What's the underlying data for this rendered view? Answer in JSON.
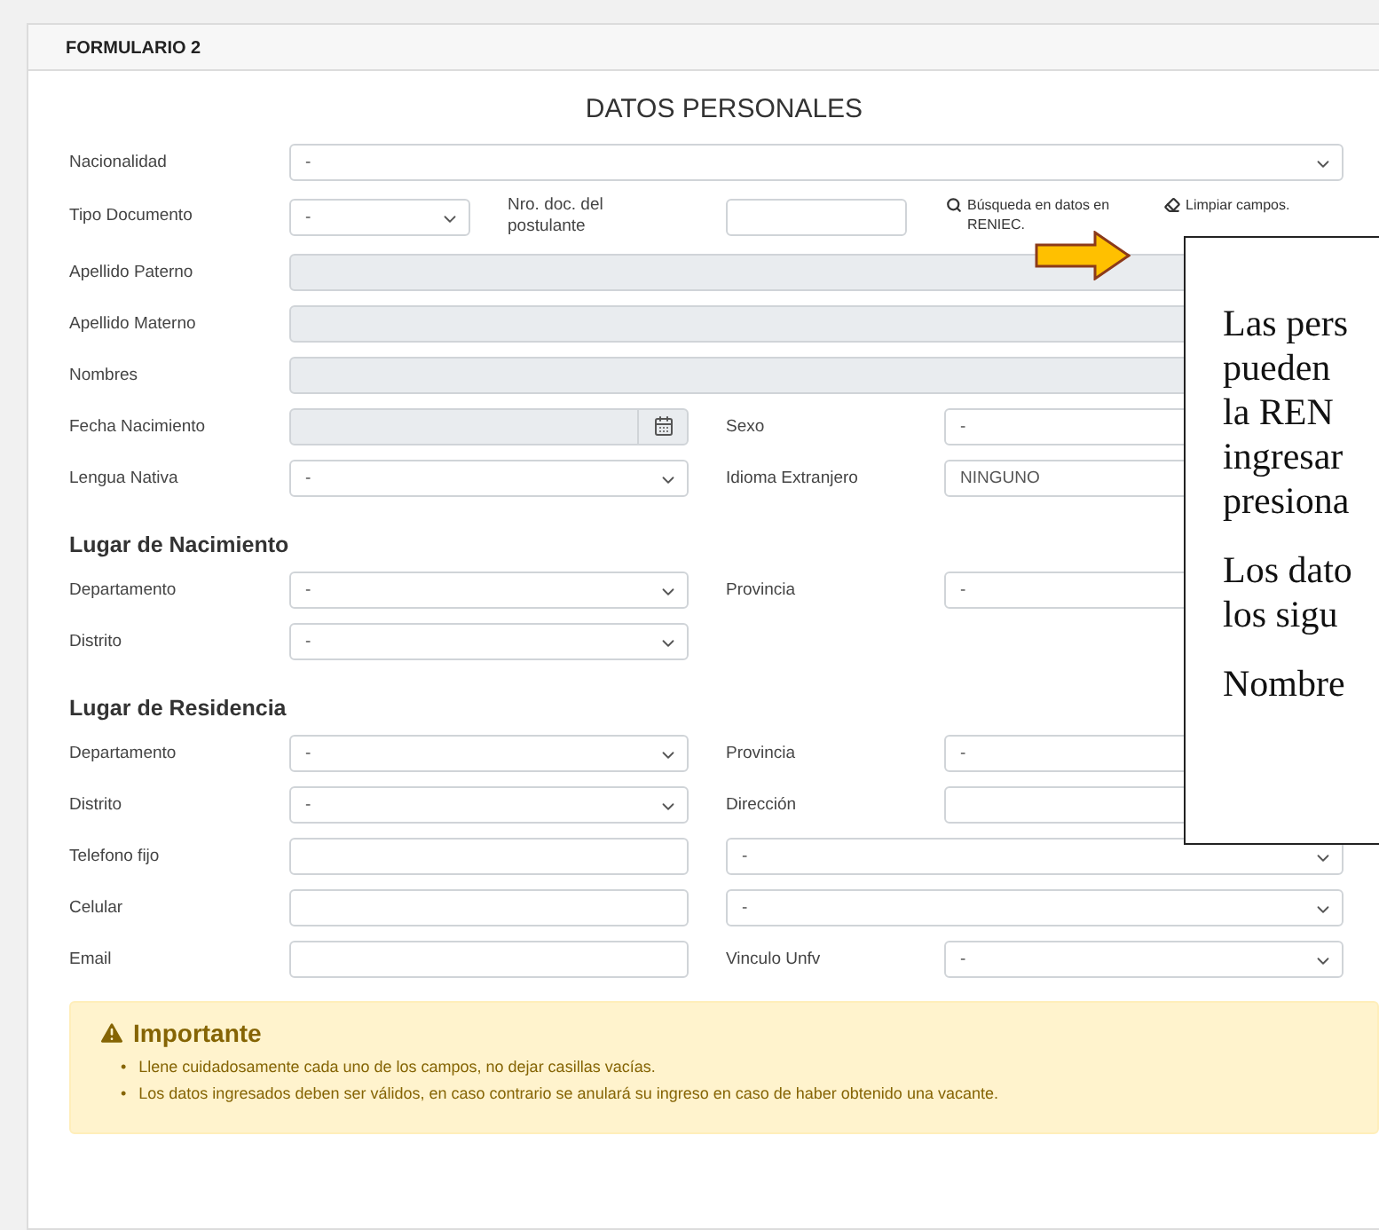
{
  "panel": {
    "title": "FORMULARIO 2"
  },
  "section_title": "DATOS PERSONALES",
  "top_rows": [
    [
      {
        "label": "Nacionalidad",
        "kind": "select-wide",
        "value": "-"
      }
    ]
  ],
  "document_row": {
    "label": "Tipo Documento",
    "type_value": "-",
    "number_label": "Nro. doc. del postulante",
    "search_link": "Búsqueda en datos en RENIEC.",
    "clear_link": "Limpiar campos."
  },
  "sections": [
    {
      "rows": [
        [
          {
            "label": "Apellido Paterno",
            "kind": "readonly-wide"
          }
        ],
        [
          {
            "label": "Apellido Materno",
            "kind": "readonly-wide"
          }
        ],
        [
          {
            "label": "Nombres",
            "kind": "readonly-wide"
          }
        ],
        [
          {
            "label": "Fecha Nacimiento",
            "kind": "date"
          },
          {
            "label": "Sexo",
            "kind": "select",
            "value": "-"
          }
        ],
        [
          {
            "label": "Lengua Nativa",
            "kind": "select",
            "value": "-"
          },
          {
            "label": "Idioma Extranjero",
            "kind": "select",
            "value": "NINGUNO"
          }
        ]
      ]
    },
    {
      "heading": "Lugar de Nacimiento",
      "rows": [
        [
          {
            "label": "Departamento",
            "kind": "select",
            "value": "-"
          },
          {
            "label": "Provincia",
            "kind": "select",
            "value": "-"
          }
        ],
        [
          {
            "label": "Distrito",
            "kind": "select",
            "value": "-"
          }
        ]
      ]
    },
    {
      "heading": "Lugar de Residencia",
      "rows": [
        [
          {
            "label": "Departamento",
            "kind": "select",
            "value": "-"
          },
          {
            "label": "Provincia",
            "kind": "select",
            "value": "-"
          }
        ],
        [
          {
            "label": "Distrito",
            "kind": "select",
            "value": "-"
          },
          {
            "label": "Dirección",
            "kind": "text"
          }
        ],
        [
          {
            "label": "Telefono fijo",
            "kind": "text"
          },
          {
            "kind": "select-long",
            "value": "-"
          }
        ],
        [
          {
            "label": "Celular",
            "kind": "text"
          },
          {
            "kind": "select-long",
            "value": "-"
          }
        ],
        [
          {
            "label": "Email",
            "kind": "text"
          },
          {
            "label": "Vinculo Unfv",
            "kind": "select",
            "value": "-"
          }
        ]
      ]
    }
  ],
  "alert": {
    "title": "Importante",
    "items": [
      {
        "bullet": "•",
        "text": "Llene cuidadosamente cada uno de los campos, no dejar casillas vacías."
      },
      {
        "bullet": "•",
        "text": "Los datos ingresados deben ser válidos, en caso contrario se anulará su ingreso en caso de haber obtenido una vacante."
      }
    ]
  },
  "callout": {
    "paragraphs": [
      [
        "Las pers",
        "pueden",
        "la REN",
        "ingresar",
        "presiona"
      ],
      [
        "Los dato",
        "los sigu"
      ],
      [
        "Nombre"
      ]
    ]
  }
}
